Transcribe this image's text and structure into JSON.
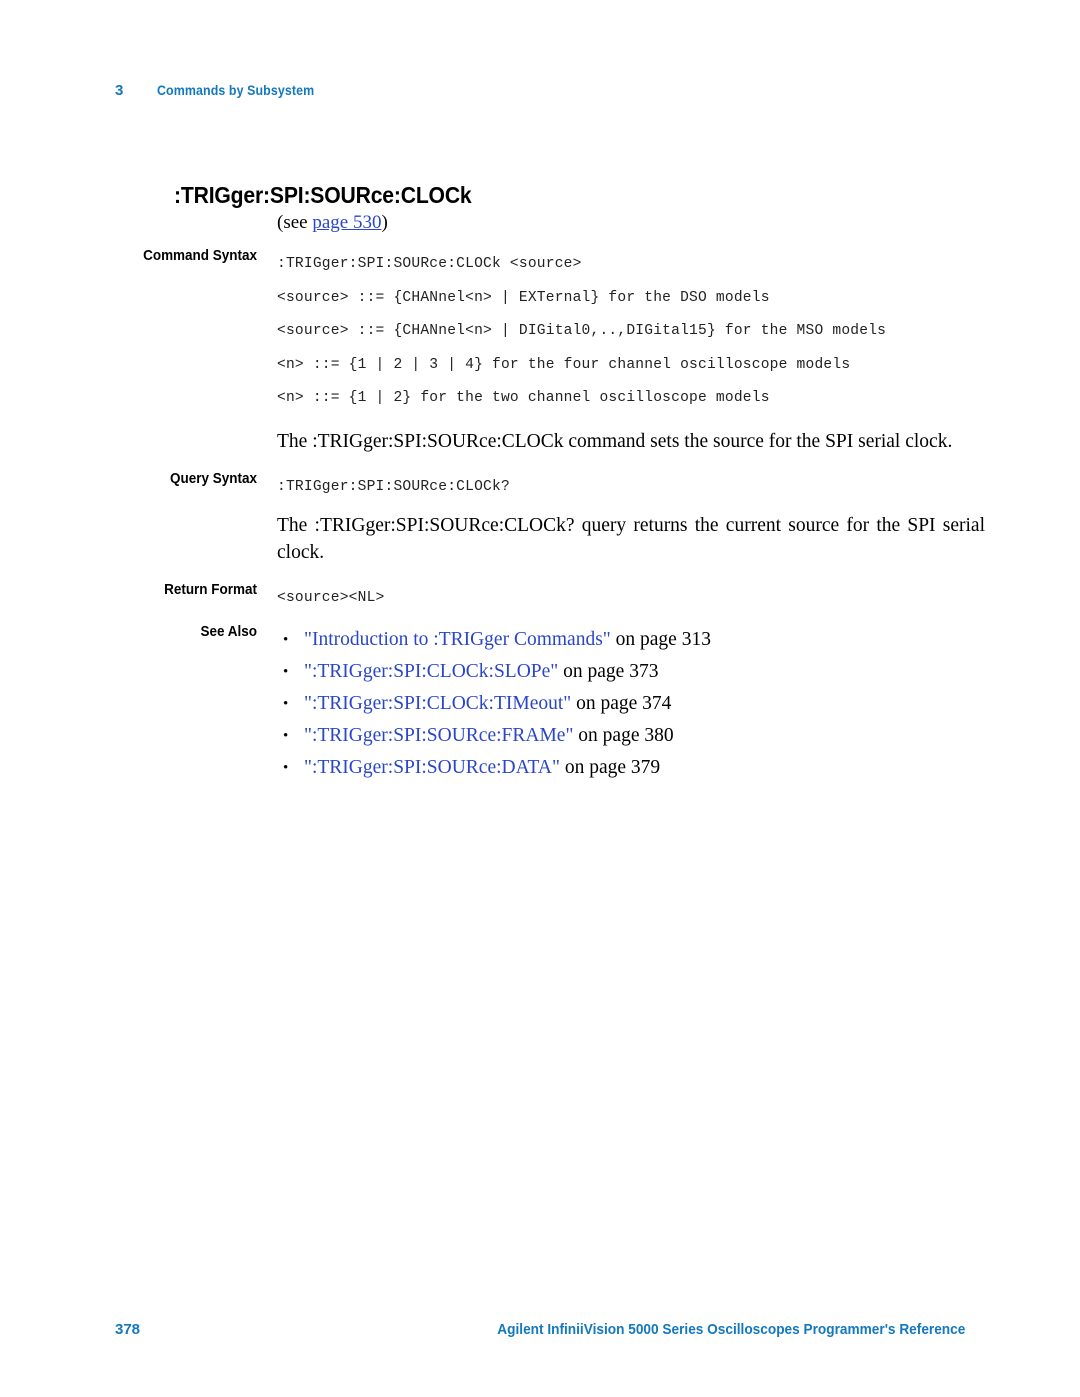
{
  "header": {
    "chapter_number": "3",
    "chapter_title": "Commands by Subsystem"
  },
  "command": {
    "title": ":TRIGger:SPI:SOURce:CLOCk",
    "see_prefix": "(see ",
    "see_link": "page 530",
    "see_suffix": ")"
  },
  "sections": {
    "command_syntax_label": "Command Syntax",
    "query_syntax_label": "Query Syntax",
    "return_format_label": "Return Format",
    "see_also_label": "See Also"
  },
  "command_syntax": {
    "lines": [
      ":TRIGger:SPI:SOURce:CLOCk <source>",
      "<source> ::= {CHANnel<n> | EXTernal} for the DSO models",
      "<source> ::= {CHANnel<n> | DIGital0,..,DIGital15} for the MSO models",
      "<n> ::= {1 | 2 | 3 | 4} for the four channel oscilloscope models",
      "<n> ::= {1 | 2} for the two channel oscilloscope models"
    ],
    "description": "The :TRIGger:SPI:SOURce:CLOCk command sets the source for the SPI serial clock."
  },
  "query_syntax": {
    "line": ":TRIGger:SPI:SOURce:CLOCk?",
    "description": "The :TRIGger:SPI:SOURce:CLOCk? query returns the current source for the SPI serial clock."
  },
  "return_format": {
    "line": "<source><NL>"
  },
  "see_also": {
    "items": [
      {
        "bullet": "•",
        "link": "\"Introduction to :TRIGger Commands\"",
        "page": " on page 313"
      },
      {
        "bullet": "•",
        "link": "\":TRIGger:SPI:CLOCk:SLOPe\"",
        "page": " on page 373"
      },
      {
        "bullet": "•",
        "link": "\":TRIGger:SPI:CLOCk:TIMeout\"",
        "page": " on page 374"
      },
      {
        "bullet": "•",
        "link": "\":TRIGger:SPI:SOURce:FRAMe\"",
        "page": " on page 380"
      },
      {
        "bullet": "•",
        "link": "\":TRIGger:SPI:SOURce:DATA\"",
        "page": " on page 379"
      }
    ]
  },
  "footer": {
    "page_number": "378",
    "document_title": "Agilent InfiniiVision 5000 Series Oscilloscopes Programmer's Reference"
  },
  "colors": {
    "brand_blue": "#1378BE",
    "link_blue": "#2A46C8",
    "text_black": "#000000"
  }
}
